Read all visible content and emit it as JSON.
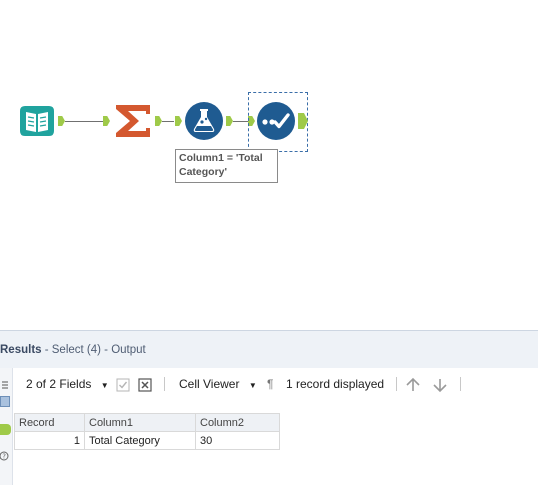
{
  "canvas": {
    "tools": [
      {
        "name": "input-data-tool",
        "icon": "book-icon",
        "color": "#20a39e"
      },
      {
        "name": "summarize-tool",
        "icon": "sigma-icon",
        "color": "#d4582f"
      },
      {
        "name": "filter-formula-tool",
        "icon": "flask-icon",
        "color": "#1f5b91"
      },
      {
        "name": "select-tool",
        "icon": "checkmark-icon",
        "color": "#1f5b91"
      }
    ],
    "annotation": {
      "line1": "Column1 = 'Total",
      "line2": "Category'"
    },
    "colors": {
      "anchor": "#9fca49",
      "selection": "#3a6ea8"
    }
  },
  "results": {
    "title": "Results",
    "subtitle": " - Select (4) - Output",
    "toolbar": {
      "fields_label": "2 of 2 Fields",
      "cell_viewer_label": "Cell Viewer",
      "pilcrow": "¶",
      "records_label": "1 record displayed"
    },
    "table": {
      "headers": [
        "Record",
        "Column1",
        "Column2"
      ],
      "rows": [
        {
          "record": "1",
          "column1": "Total Category",
          "column2": "30"
        }
      ]
    }
  }
}
